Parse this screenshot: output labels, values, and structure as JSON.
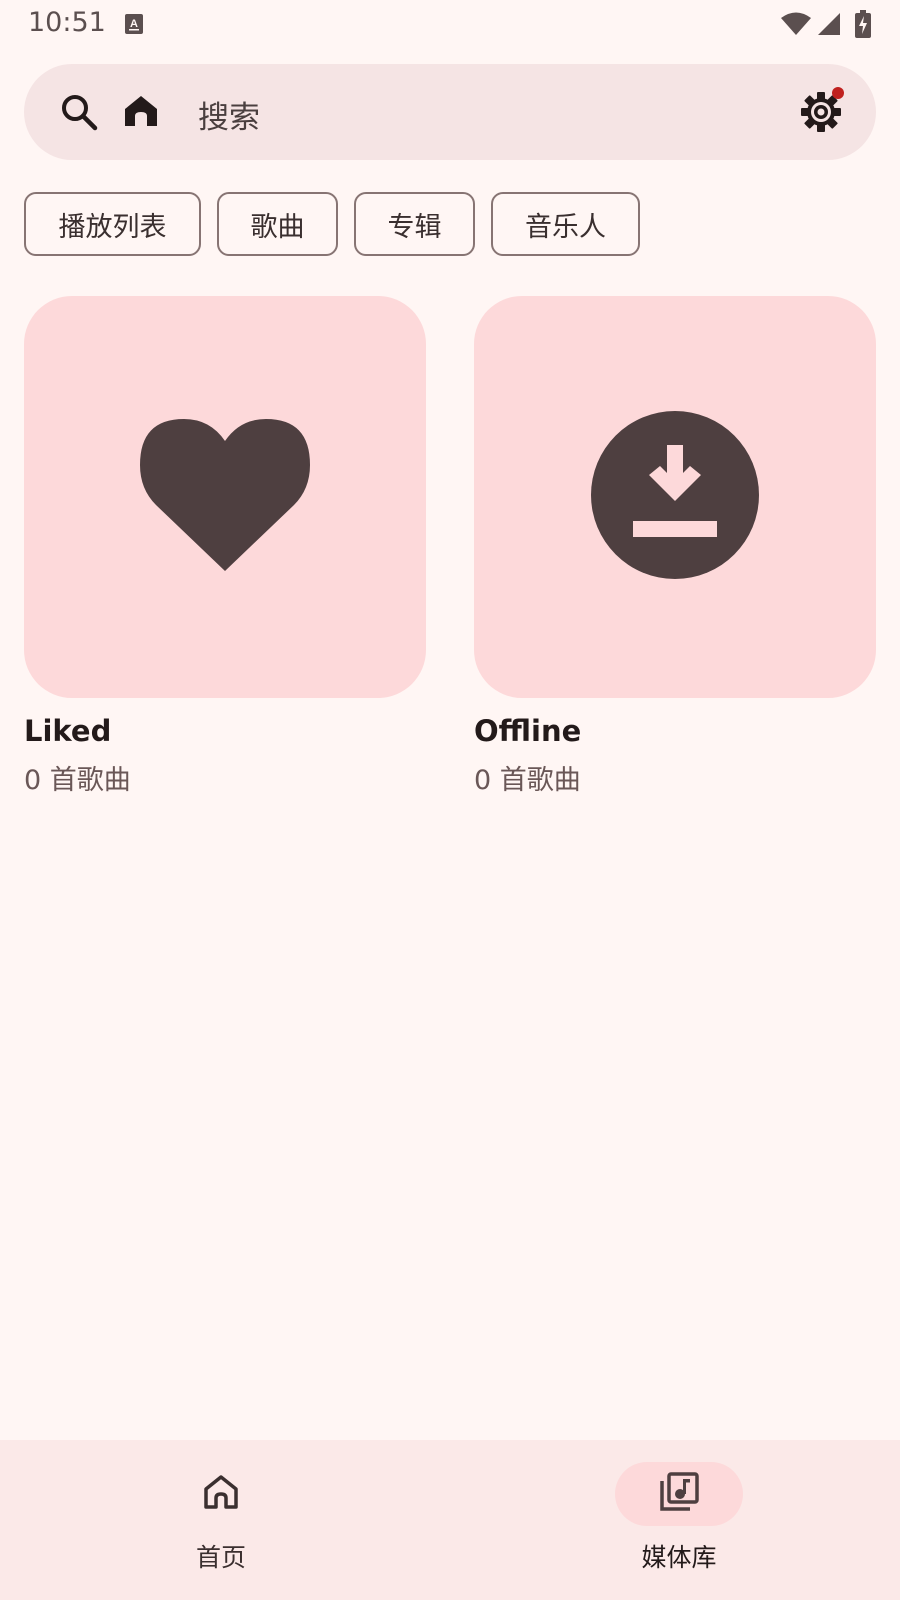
{
  "status_bar": {
    "time": "10:51",
    "icons": [
      "app-notification-icon",
      "wifi-icon",
      "signal-icon",
      "battery-charging-icon"
    ]
  },
  "search": {
    "placeholder": "搜索",
    "icons": [
      "search-icon",
      "home-icon",
      "settings-icon"
    ],
    "settings_badge_color": "#C0211F"
  },
  "filter_chips": [
    {
      "label": "播放列表"
    },
    {
      "label": "歌曲"
    },
    {
      "label": "专辑"
    },
    {
      "label": "音乐人"
    }
  ],
  "library_cards": [
    {
      "title": "Liked",
      "subtitle": "0 首歌曲",
      "icon": "heart-icon"
    },
    {
      "title": "Offline",
      "subtitle": "0 首歌曲",
      "icon": "download-icon"
    }
  ],
  "bottom_nav": {
    "items": [
      {
        "label": "首页",
        "icon": "home-outline-icon",
        "active": false
      },
      {
        "label": "媒体库",
        "icon": "library-music-icon",
        "active": true
      }
    ]
  },
  "colors": {
    "background": "#FFF6F4",
    "surface": "#F5E4E4",
    "card": "#FDD9DA",
    "icon_dark": "#4E3F40",
    "accent_active": "#FDD9DA"
  }
}
